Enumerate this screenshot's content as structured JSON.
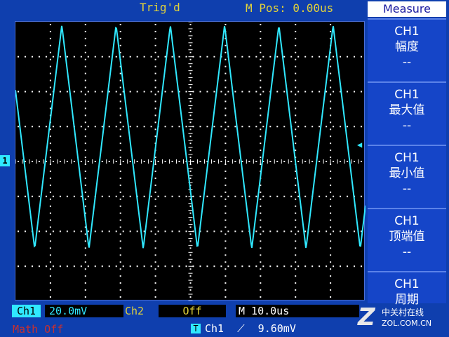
{
  "header": {
    "trigger_status": "Trig'd",
    "horizontal_position": "M Pos: 0.00us"
  },
  "measure_menu": {
    "title": "Measure",
    "items": [
      {
        "channel": "CH1",
        "name": "幅度",
        "value": "--"
      },
      {
        "channel": "CH1",
        "name": "最大值",
        "value": "--"
      },
      {
        "channel": "CH1",
        "name": "最小值",
        "value": "--"
      },
      {
        "channel": "CH1",
        "name": "顶端值",
        "value": "--"
      },
      {
        "channel": "CH1",
        "name": "周期",
        "value": ""
      }
    ]
  },
  "markers": {
    "channel_marker": "1",
    "trigger_position_marker": "▼",
    "trigger_level_marker": "◀"
  },
  "status_bar": {
    "ch1_label": "Ch1",
    "ch1_scale": "20.0mV",
    "ch2_label": "Ch2",
    "ch2_scale": "Off",
    "timebase": "M 10.0us",
    "math": "Math Off",
    "trigger_badge": "T",
    "trigger_source": "Ch1",
    "trigger_slope": "⟋",
    "trigger_level": "9.60mV"
  },
  "watermark": {
    "logo": "Z",
    "text": "中关村在线",
    "url": "ZOL.COM.CN"
  },
  "colors": {
    "ch1": "#30e8ff",
    "ch2": "#e2d23a",
    "background": "#0f3fae",
    "math": "#c83030"
  },
  "waveform": {
    "shape": "triangle",
    "period_divisions": 1.55,
    "amplitude_divisions": 3.2,
    "offset_divisions": -0.7,
    "phase_divisions": 0.55
  }
}
